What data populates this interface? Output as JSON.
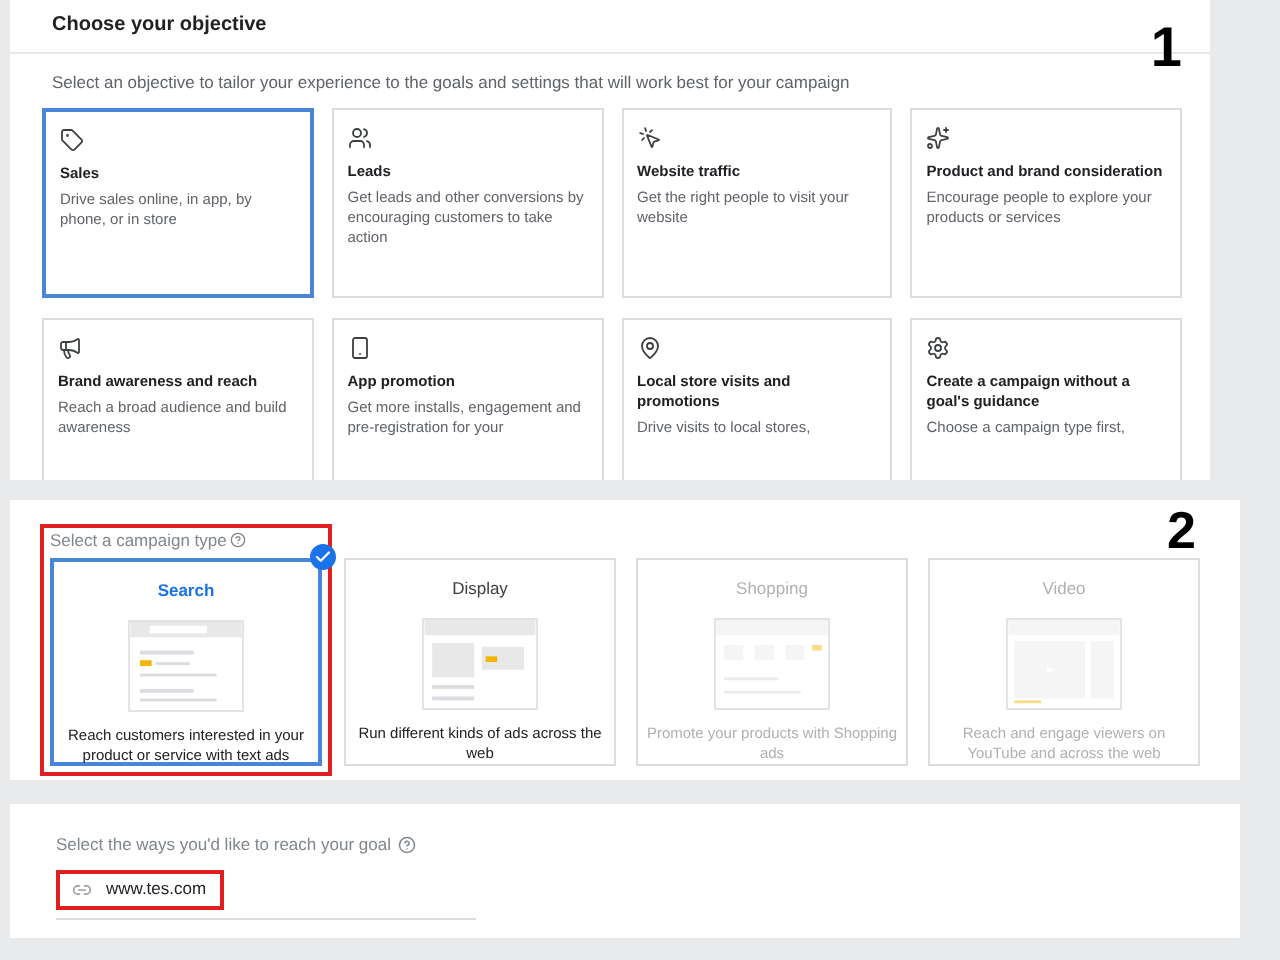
{
  "objective": {
    "title": "Choose your objective",
    "step": "1",
    "description": "Select an objective to tailor your experience to the goals and settings that will work best for your campaign",
    "cards": [
      {
        "title": "Sales",
        "description": "Drive sales online, in app, by phone, or in store",
        "selected": true
      },
      {
        "title": "Leads",
        "description": "Get leads and other conversions by encouraging customers to take action",
        "selected": false
      },
      {
        "title": "Website traffic",
        "description": "Get the right people to visit your website",
        "selected": false
      },
      {
        "title": "Product and brand consideration",
        "description": "Encourage people to explore your products or services",
        "selected": false
      },
      {
        "title": "Brand awareness and reach",
        "description": "Reach a broad audience and build awareness",
        "selected": false
      },
      {
        "title": "App promotion",
        "description": "Get more installs, engagement and pre-registration for your",
        "selected": false
      },
      {
        "title": "Local store visits and promotions",
        "description": "Drive visits to local stores,",
        "selected": false
      },
      {
        "title": "Create a campaign without a goal's guidance",
        "description": "Choose a campaign type first,",
        "selected": false
      }
    ]
  },
  "campaign_type": {
    "label": "Select a campaign type",
    "step": "2",
    "highlighted": true,
    "cards": [
      {
        "kind": "search",
        "title": "Search",
        "description": "Reach customers interested in your product or service with text ads",
        "selected": true,
        "disabled": false
      },
      {
        "kind": "display",
        "title": "Display",
        "description": "Run different kinds of ads across the web",
        "selected": false,
        "disabled": false
      },
      {
        "kind": "shopping",
        "title": "Shopping",
        "description": "Promote your products with Shopping ads",
        "selected": false,
        "disabled": true
      },
      {
        "kind": "video",
        "title": "Video",
        "description": "Reach and engage viewers on YouTube and across the web",
        "selected": false,
        "disabled": true
      }
    ]
  },
  "reach": {
    "label": "Select the ways you'd like to reach your goal",
    "url_field": {
      "value": "www.tes.com",
      "highlighted": true
    }
  }
}
